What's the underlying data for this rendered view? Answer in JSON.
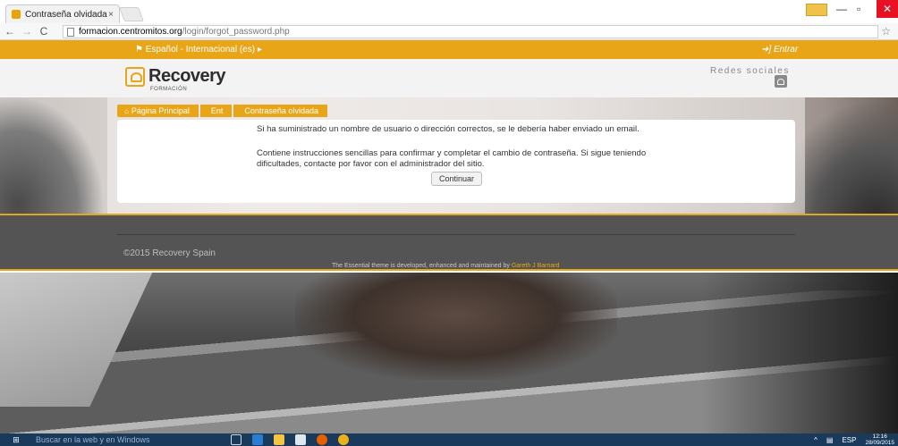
{
  "browser": {
    "tab_title": "Contraseña olvidada",
    "tab_close": "×",
    "user_badge": " ",
    "url_host": "formacion.centromitos.org",
    "url_path": "/login/forgot_password.php"
  },
  "topnav": {
    "language": "Español - Internacional (es)",
    "login": "Entrar"
  },
  "header": {
    "logo_text": "Recovery",
    "logo_sub": "FORMACIÓN",
    "social_title": "Redes sociales"
  },
  "breadcrumb": [
    "Página Principal",
    "Ent",
    "Contraseña olvidada"
  ],
  "content": {
    "message_1": "Si ha suministrado un nombre de usuario o dirección correctos, se le debería haber enviado un email.",
    "message_2": "Contiene instrucciones sencillas para confirmar y completar el cambio de contraseña. Si sigue teniendo dificultades, contacte por favor con el administrador del sitio.",
    "continue_label": "Continuar"
  },
  "footer": {
    "copyright": "©2015 Recovery Spain",
    "theme_credit": "The Essential theme is developed, enhanced and maintained by",
    "theme_author": "Gareth J Barnard"
  },
  "taskbar": {
    "search_placeholder": "Buscar en la web y en Windows",
    "language": "ESP",
    "time": "12:16",
    "date": "28/09/2015"
  },
  "colors": {
    "accent": "#e8a517",
    "footer_bg": "#545454",
    "taskbar_bg": "#1a3a5c"
  }
}
